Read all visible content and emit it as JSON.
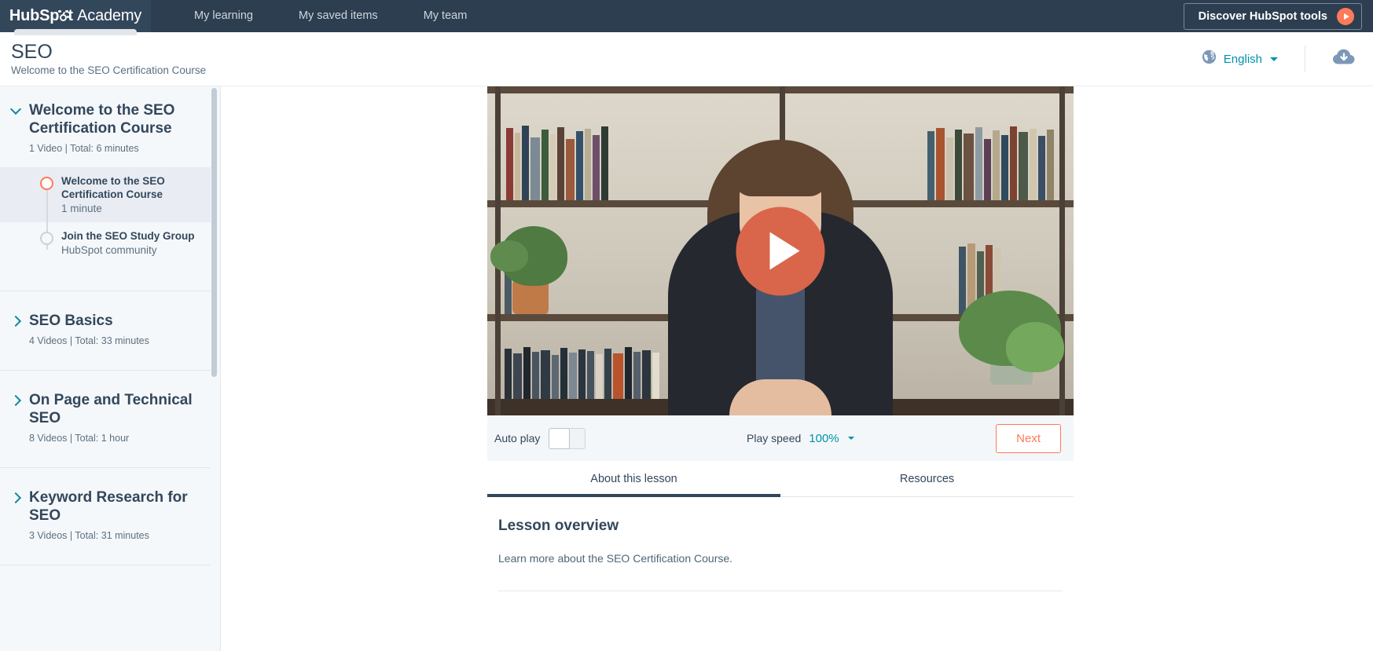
{
  "topnav": {
    "logo": {
      "brand": "HubSp",
      "brand_tail": "t",
      "suffix": "Academy",
      "icon": "sprocket-icon"
    },
    "links": [
      {
        "label": "My learning"
      },
      {
        "label": "My saved items"
      },
      {
        "label": "My team"
      }
    ],
    "discover_button": {
      "label": "Discover HubSpot tools",
      "icon": "play-circle-icon"
    }
  },
  "course_header": {
    "title": "SEO",
    "subtitle": "Welcome to the SEO Certification Course",
    "globe_icon": "globe-icon",
    "language": "English",
    "download_icon": "cloud-download-icon"
  },
  "sidebar": {
    "sections": [
      {
        "title": "Welcome to the SEO Certification Course",
        "meta": "1 Video | Total: 6 minutes",
        "expanded": true,
        "chevron": "chevron-down-icon",
        "lessons": [
          {
            "title": "Welcome to the SEO Certification Course",
            "sub": "1 minute",
            "active": true
          },
          {
            "title": "Join the SEO Study Group",
            "sub": "HubSpot community",
            "active": false
          }
        ]
      },
      {
        "title": "SEO Basics",
        "meta": "4 Videos | Total: 33 minutes",
        "expanded": false,
        "chevron": "chevron-right-icon",
        "lessons": []
      },
      {
        "title": "On Page and Technical SEO",
        "meta": "8 Videos | Total: 1 hour",
        "expanded": false,
        "chevron": "chevron-right-icon",
        "lessons": []
      },
      {
        "title": "Keyword Research for SEO",
        "meta": "3 Videos | Total: 31 minutes",
        "expanded": false,
        "chevron": "chevron-right-icon",
        "lessons": []
      }
    ]
  },
  "player": {
    "poster_alt": "Instructor seated in front of a bookshelf",
    "play_icon": "play-icon",
    "autoplay_label": "Auto play",
    "autoplay_on": false,
    "play_speed_label": "Play speed",
    "play_speed_value": "100%",
    "next_label": "Next"
  },
  "tabs": [
    {
      "label": "About this lesson",
      "active": true
    },
    {
      "label": "Resources",
      "active": false
    }
  ],
  "lesson": {
    "heading": "Lesson overview",
    "body": "Learn more about the SEO Certification Course."
  },
  "colors": {
    "navy": "#2d3e50",
    "navy_logo": "#33475b",
    "orange": "#ff7a59",
    "teal": "#0091ae",
    "sidebar_bg": "#f5f8fa"
  }
}
